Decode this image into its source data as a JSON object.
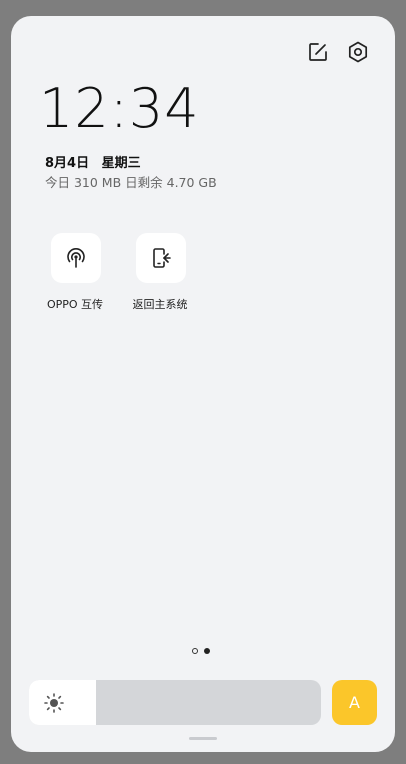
{
  "header": {
    "edit_icon": "edit-icon",
    "settings_icon": "gear-icon"
  },
  "status": {
    "time": "12:34",
    "date": "8月4日",
    "weekday": "星期三",
    "data_usage": "今日 310 MB 日剩余 4.70 GB"
  },
  "tiles": [
    {
      "label": "OPPO 互传",
      "icon": "share-signal-icon"
    },
    {
      "label": "返回主系统",
      "icon": "exit-system-icon"
    }
  ],
  "pager": {
    "total": 2,
    "current": 2
  },
  "brightness": {
    "level": 0.23,
    "icon": "sun-icon"
  },
  "auto_brightness": {
    "label": "A",
    "color": "#fbc62a"
  }
}
